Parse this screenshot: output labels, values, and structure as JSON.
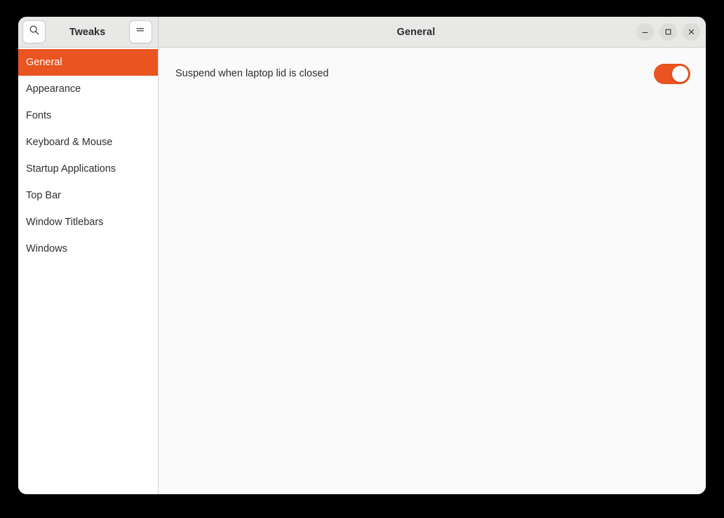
{
  "window": {
    "app_title": "Tweaks",
    "header_title": "General",
    "search_icon": "search-icon",
    "menu_icon": "hamburger-menu-icon",
    "controls": {
      "minimize": "minimize-icon",
      "maximize": "maximize-icon",
      "close": "close-icon"
    }
  },
  "sidebar": {
    "items": [
      {
        "label": "General",
        "selected": true
      },
      {
        "label": "Appearance",
        "selected": false
      },
      {
        "label": "Fonts",
        "selected": false
      },
      {
        "label": "Keyboard & Mouse",
        "selected": false
      },
      {
        "label": "Startup Applications",
        "selected": false
      },
      {
        "label": "Top Bar",
        "selected": false
      },
      {
        "label": "Window Titlebars",
        "selected": false
      },
      {
        "label": "Windows",
        "selected": false
      }
    ]
  },
  "content": {
    "settings": [
      {
        "label": "Suspend when laptop lid is closed",
        "toggle_state": "on"
      }
    ]
  },
  "colors": {
    "accent": "#e95420",
    "headerbar": "#e8e8e7",
    "sidebar_bg": "#ffffff",
    "content_bg": "#fafafa",
    "text": "#2e2e2e",
    "backdrop": "#000000"
  }
}
